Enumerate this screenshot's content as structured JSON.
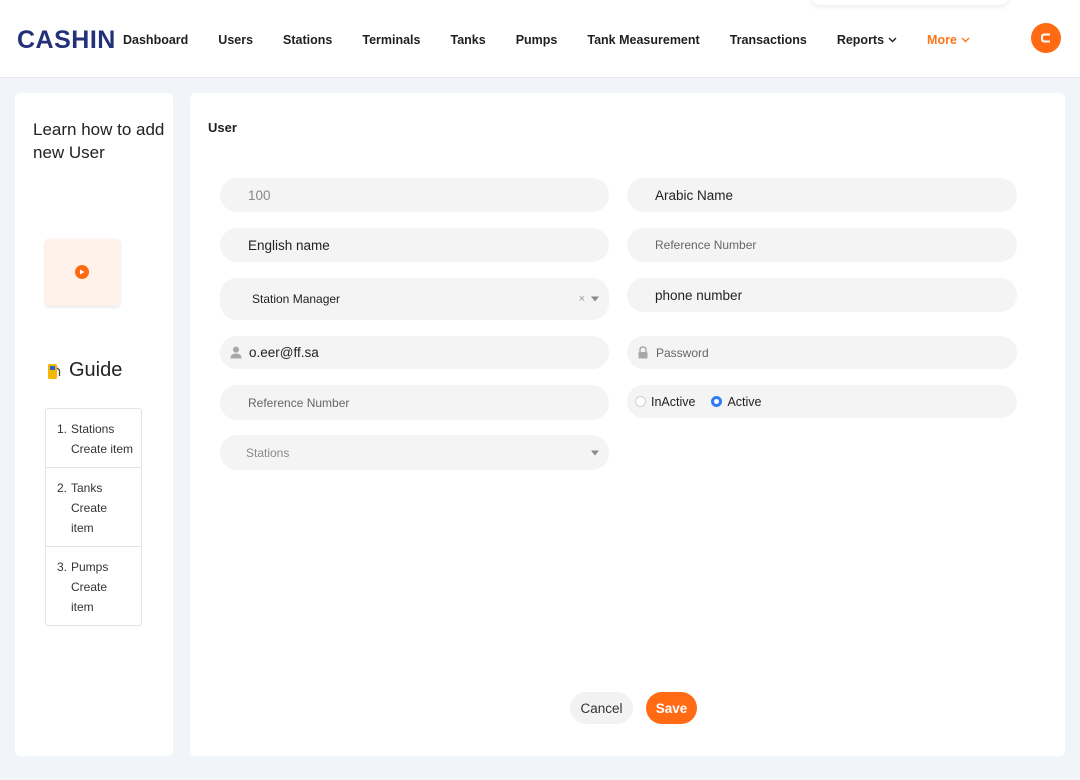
{
  "brand": {
    "logo": "CASHIN",
    "accent": "#ff6a13",
    "navy": "#23317a"
  },
  "nav": {
    "items": [
      {
        "label": "Dashboard"
      },
      {
        "label": "Users"
      },
      {
        "label": "Stations"
      },
      {
        "label": "Terminals"
      },
      {
        "label": "Tanks"
      },
      {
        "label": "Pumps"
      },
      {
        "label": "Tank Measurement"
      },
      {
        "label": "Transactions"
      },
      {
        "label": "Reports"
      },
      {
        "label": "More"
      }
    ]
  },
  "sidebar": {
    "title": "Learn how to add new User",
    "guide_label": "Guide",
    "guide": [
      {
        "num": "1.",
        "name": "Stations",
        "action": "Create item"
      },
      {
        "num": "2.",
        "name": "Tanks",
        "action": "Create item"
      },
      {
        "num": "3.",
        "name": "Pumps",
        "action": "Create item"
      }
    ]
  },
  "form": {
    "title": "User",
    "id_value": "100",
    "arabic_name": "Arabic Name",
    "english_name": "English name",
    "reference_placeholder": "Reference Number",
    "role_value": "Station Manager",
    "phone_value": "phone number",
    "email_value": "o.eer@ff.sa",
    "password_placeholder": "Password",
    "reference2_placeholder": "Reference Number",
    "stations_placeholder": "Stations",
    "status_options": [
      "InActive",
      "Active"
    ],
    "status_selected": "Active",
    "clear_glyph": "×"
  },
  "actions": {
    "cancel": "Cancel",
    "save": "Save"
  }
}
